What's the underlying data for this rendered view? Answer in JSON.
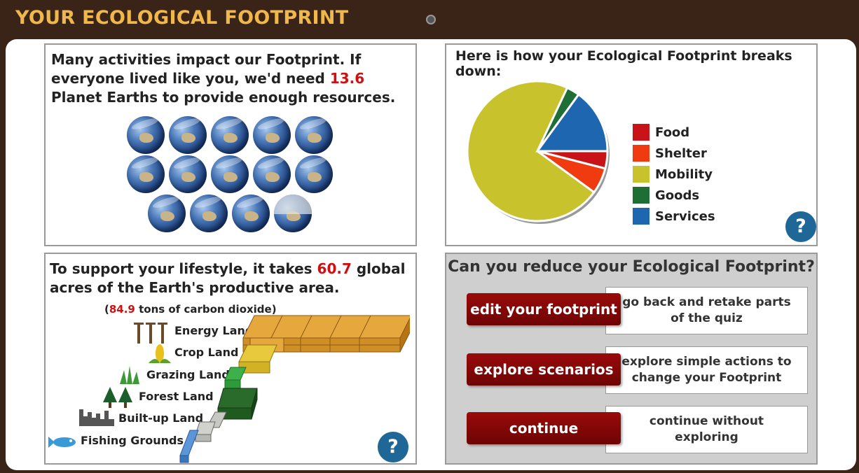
{
  "app": {
    "title": "YOUR ECOLOGICAL FOOTPRINT"
  },
  "planets": {
    "text_before": "Many activities impact our Footprint. If everyone lived like you, we'd need ",
    "value": "13.6",
    "text_after": " Planet Earths to provide enough resources.",
    "full_count": 13,
    "partial_fraction": 0.6
  },
  "breakdown": {
    "title": "Here is how your Ecological Footprint breaks down:",
    "help_label": "?",
    "chart_data": {
      "type": "pie",
      "slices": [
        {
          "label": "Food",
          "value": 4,
          "color": "#c81418"
        },
        {
          "label": "Shelter",
          "value": 6,
          "color": "#f03a10"
        },
        {
          "label": "Mobility",
          "value": 72,
          "color": "#c8c22c"
        },
        {
          "label": "Goods",
          "value": 3,
          "color": "#1f6e36"
        },
        {
          "label": "Services",
          "value": 15,
          "color": "#1f66b0"
        }
      ],
      "legend": "right"
    }
  },
  "acres": {
    "text_before": "To support your lifestyle, it takes ",
    "value": "60.7",
    "text_after": " global acres of the Earth's productive area.",
    "co2_open": "(",
    "co2_value": "84.9",
    "co2_text": " tons of carbon dioxide)",
    "lands": [
      "Energy Land",
      "Crop Land",
      "Grazing Land",
      "Forest Land",
      "Built-up Land",
      "Fishing Grounds"
    ],
    "help_label": "?"
  },
  "reduce": {
    "title": "Can you reduce your Ecological Footprint?",
    "options": [
      {
        "button": "edit your footprint",
        "description": "go back and retake parts of the quiz"
      },
      {
        "button": "explore scenarios",
        "description": "explore simple actions to change your Footprint"
      },
      {
        "button": "continue",
        "description": "continue without exploring"
      }
    ]
  },
  "colors": {
    "accent": "#f0b84a",
    "frame": "#3a2418",
    "button": "#8a0808",
    "highlight": "#d01010",
    "help": "#1f6796"
  }
}
